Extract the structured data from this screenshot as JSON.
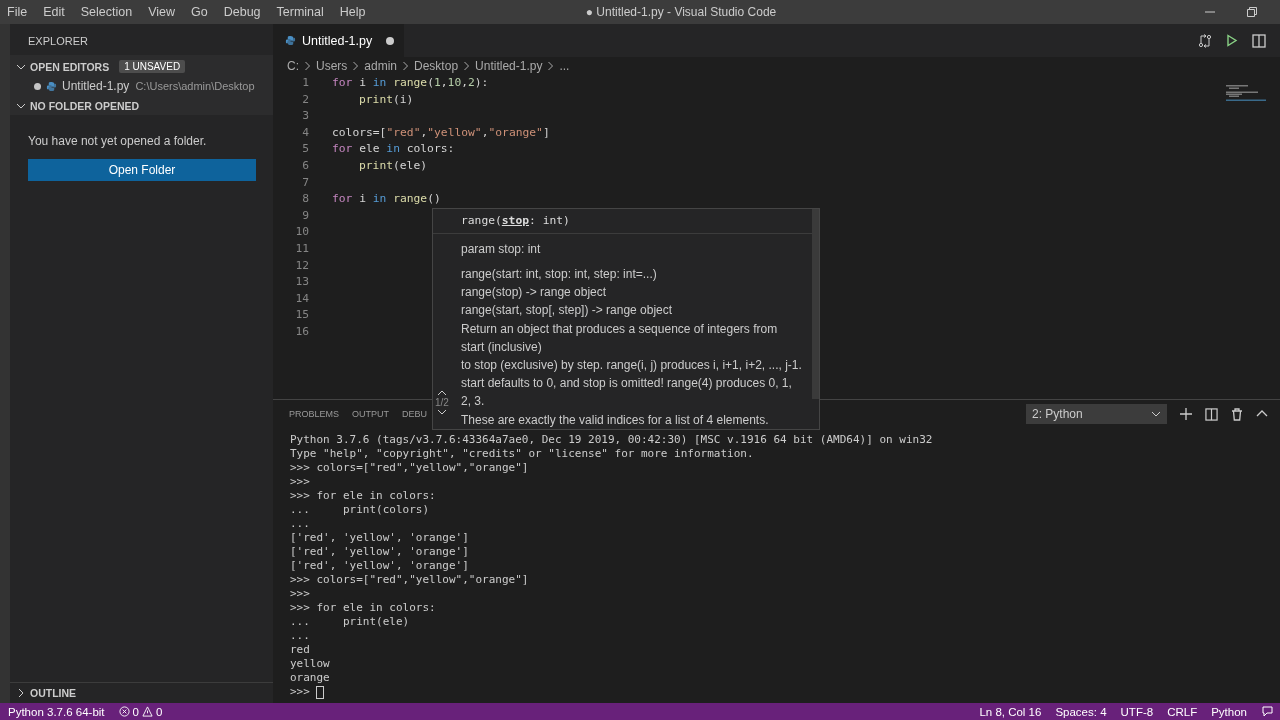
{
  "menu": [
    "File",
    "Edit",
    "Selection",
    "View",
    "Go",
    "Debug",
    "Terminal",
    "Help"
  ],
  "window": {
    "title": "● Untitled-1.py - Visual Studio Code"
  },
  "sidebar": {
    "title": "EXPLORER",
    "open_editors": {
      "label": "OPEN EDITORS",
      "badge": "1 UNSAVED",
      "expanded": true,
      "items": [
        {
          "name": "Untitled-1.py",
          "path": "C:\\Users\\admin\\Desktop",
          "unsaved": true
        }
      ]
    },
    "no_folder": {
      "label": "NO FOLDER OPENED",
      "expanded": true,
      "message": "You have not yet opened a folder.",
      "button": "Open Folder"
    },
    "outline": {
      "label": "OUTLINE",
      "expanded": false
    }
  },
  "tabs": [
    {
      "label": "Untitled-1.py",
      "selected": true,
      "unsaved": true
    }
  ],
  "breadcrumb": [
    "C:",
    "Users",
    "admin",
    "Desktop",
    "Untitled-1.py",
    "..."
  ],
  "code": [
    {
      "number": "1",
      "indented": false,
      "tokens": [
        {
          "text": "for",
          "kind": "keyword"
        },
        {
          "text": "i",
          "kind": "name"
        },
        {
          "text": "in",
          "kind": "operator"
        },
        {
          "text": "range",
          "kind": "function"
        },
        {
          "text": "(",
          "kind": "punct"
        },
        {
          "text": "1",
          "kind": "number"
        },
        {
          "text": ",",
          "kind": "punct"
        },
        {
          "text": "10",
          "kind": "number"
        },
        {
          "text": ",",
          "kind": "punct"
        },
        {
          "text": "2",
          "kind": "number"
        },
        {
          "text": "):",
          "kind": "punct"
        }
      ]
    },
    {
      "number": "2",
      "indented": true,
      "tokens": [
        {
          "text": "print",
          "kind": "function"
        },
        {
          "text": "(i)",
          "kind": "punct"
        }
      ]
    },
    {
      "number": "3"
    },
    {
      "number": "4",
      "indented": false,
      "tokens": [
        {
          "text": "colors=[",
          "kind": "punct"
        },
        {
          "text": "\"red\"",
          "kind": "string"
        },
        {
          "text": ",",
          "kind": "punct"
        },
        {
          "text": "\"yellow\"",
          "kind": "string"
        },
        {
          "text": ",",
          "kind": "punct"
        },
        {
          "text": "\"orange\"",
          "kind": "string"
        },
        {
          "text": "]",
          "kind": "punct"
        }
      ]
    },
    {
      "number": "5",
      "indented": false,
      "tokens": [
        {
          "text": "for",
          "kind": "keyword"
        },
        {
          "text": "ele",
          "kind": "name"
        },
        {
          "text": "in",
          "kind": "operator"
        },
        {
          "text": "colors:",
          "kind": "name"
        }
      ]
    },
    {
      "number": "6",
      "indented": true,
      "tokens": [
        {
          "text": "print",
          "kind": "function"
        },
        {
          "text": "(ele)",
          "kind": "punct"
        }
      ]
    },
    {
      "number": "7"
    },
    {
      "number": "8",
      "indented": false,
      "tokens": [
        {
          "text": "for",
          "kind": "keyword"
        },
        {
          "text": "i",
          "kind": "name"
        },
        {
          "text": "in",
          "kind": "operator"
        },
        {
          "text": "range",
          "kind": "function"
        },
        {
          "text": "()",
          "kind": "punct"
        }
      ]
    },
    {
      "number": "9"
    },
    {
      "number": "10"
    },
    {
      "number": "11"
    },
    {
      "number": "12"
    },
    {
      "number": "13"
    },
    {
      "number": "14"
    },
    {
      "number": "15"
    },
    {
      "number": "16"
    }
  ],
  "hover": {
    "signature": "range(**stop**: int)",
    "param": "param stop: int",
    "doc": [
      "range(start: int, stop: int, step: int=...)",
      "range(stop) -> range object",
      "range(start, stop[, step]) -> range object",
      "Return an object that produces a sequence of integers from",
      "start (inclusive)",
      "to stop (exclusive) by step.  range(i, j) produces i, i+1, i+2, ..., j-1.",
      "start defaults to 0, and stop is omitted!  range(4) produces 0, 1,",
      "2, 3.",
      "These are exactly the valid indices for a list of 4 elements."
    ],
    "counter": "1/2"
  },
  "panel": {
    "tabs": [
      {
        "label": "PROBLEMS",
        "selected": false
      },
      {
        "label": "OUTPUT",
        "selected": false
      },
      {
        "label": "DEBU",
        "selected": false
      }
    ],
    "terminal_select": "2: Python",
    "terminal": [
      "Python 3.7.6 (tags/v3.7.6:43364a7ae0, Dec 19 2019, 00:42:30) [MSC v.1916 64 bit (AMD64)] on win32",
      "Type \"help\", \"copyright\", \"credits\" or \"license\" for more information.",
      ">>> colors=[\"red\",\"yellow\",\"orange\"]",
      ">>>",
      ">>> for ele in colors:",
      "...     print(colors)",
      "...",
      "['red', 'yellow', 'orange']",
      "['red', 'yellow', 'orange']",
      "['red', 'yellow', 'orange']",
      ">>> colors=[\"red\",\"yellow\",\"orange\"]",
      ">>>",
      ">>> for ele in colors:",
      "...     print(ele)",
      "...",
      "red",
      "yellow",
      "orange",
      ">>>"
    ]
  },
  "status_bar": {
    "interpreter": "Python 3.7.6 64-bit",
    "errors": "0",
    "warnings": "0",
    "position": "Ln 8, Col 16",
    "spaces": "Spaces: 4",
    "encoding": "UTF-8",
    "eol": "CRLF",
    "language": "Python"
  }
}
